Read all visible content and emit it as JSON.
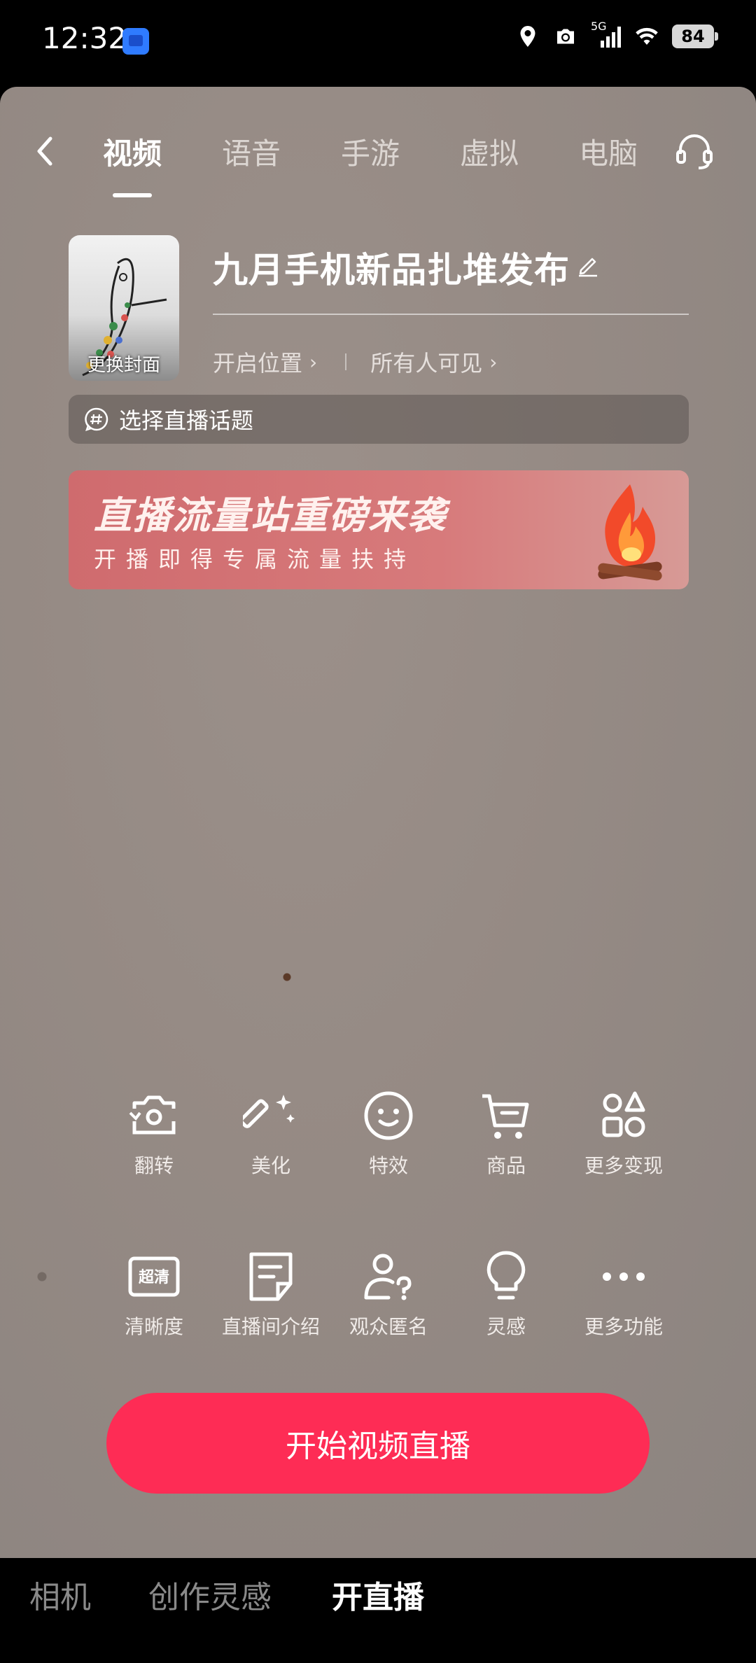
{
  "status_bar": {
    "time": "12:32",
    "network": "5G",
    "battery": "84"
  },
  "tabs": [
    {
      "label": "视频",
      "active": true
    },
    {
      "label": "语音",
      "active": false
    },
    {
      "label": "手游",
      "active": false
    },
    {
      "label": "虚拟",
      "active": false
    },
    {
      "label": "电脑",
      "active": false
    }
  ],
  "cover": {
    "label": "更换封面"
  },
  "title": "九月手机新品扎堆发布",
  "meta": {
    "location": "开启位置",
    "visibility": "所有人可见"
  },
  "topic": {
    "label": "选择直播话题"
  },
  "banner": {
    "title": "直播流量站重磅来袭",
    "subtitle": "开播即得专属流量扶持"
  },
  "tools_row1": [
    {
      "label": "翻转",
      "icon": "flip-camera-icon"
    },
    {
      "label": "美化",
      "icon": "magic-wand-icon"
    },
    {
      "label": "特效",
      "icon": "smile-face-icon"
    },
    {
      "label": "商品",
      "icon": "shopping-cart-icon"
    },
    {
      "label": "更多变现",
      "icon": "shapes-grid-icon"
    }
  ],
  "tools_row2": [
    {
      "label": "清晰度",
      "icon": "hd-quality-icon",
      "badge": "超清"
    },
    {
      "label": "直播间介绍",
      "icon": "note-edit-icon"
    },
    {
      "label": "观众匿名",
      "icon": "anonymous-user-icon"
    },
    {
      "label": "灵感",
      "icon": "lightbulb-icon"
    },
    {
      "label": "更多功能",
      "icon": "more-dots-icon"
    }
  ],
  "start_button": {
    "label": "开始视频直播"
  },
  "bottom_nav": [
    {
      "label": "相机",
      "active": false
    },
    {
      "label": "创作灵感",
      "active": false
    },
    {
      "label": "开直播",
      "active": true
    }
  ],
  "colors": {
    "accent": "#fe2c55",
    "banner": "#d4767a"
  }
}
